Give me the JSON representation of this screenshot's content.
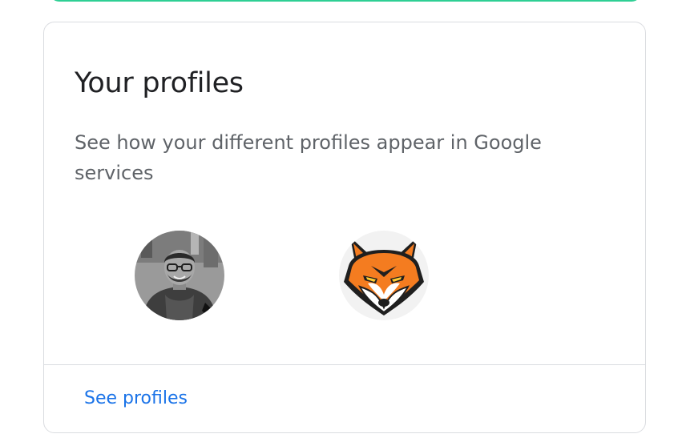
{
  "card": {
    "title": "Your profiles",
    "description": "See how your different profiles appear in Google services",
    "profiles": [
      {
        "avatar": "person-photo",
        "style": "grayscale"
      },
      {
        "avatar": "fox-mascot",
        "style": "color"
      }
    ],
    "footer_link": "See profiles"
  },
  "colors": {
    "accent": "#1a73e8",
    "top_strip": "#2ecf94",
    "border": "#dadce0",
    "title": "#202124",
    "body_text": "#5f6368",
    "fox_orange": "#f47c20"
  }
}
